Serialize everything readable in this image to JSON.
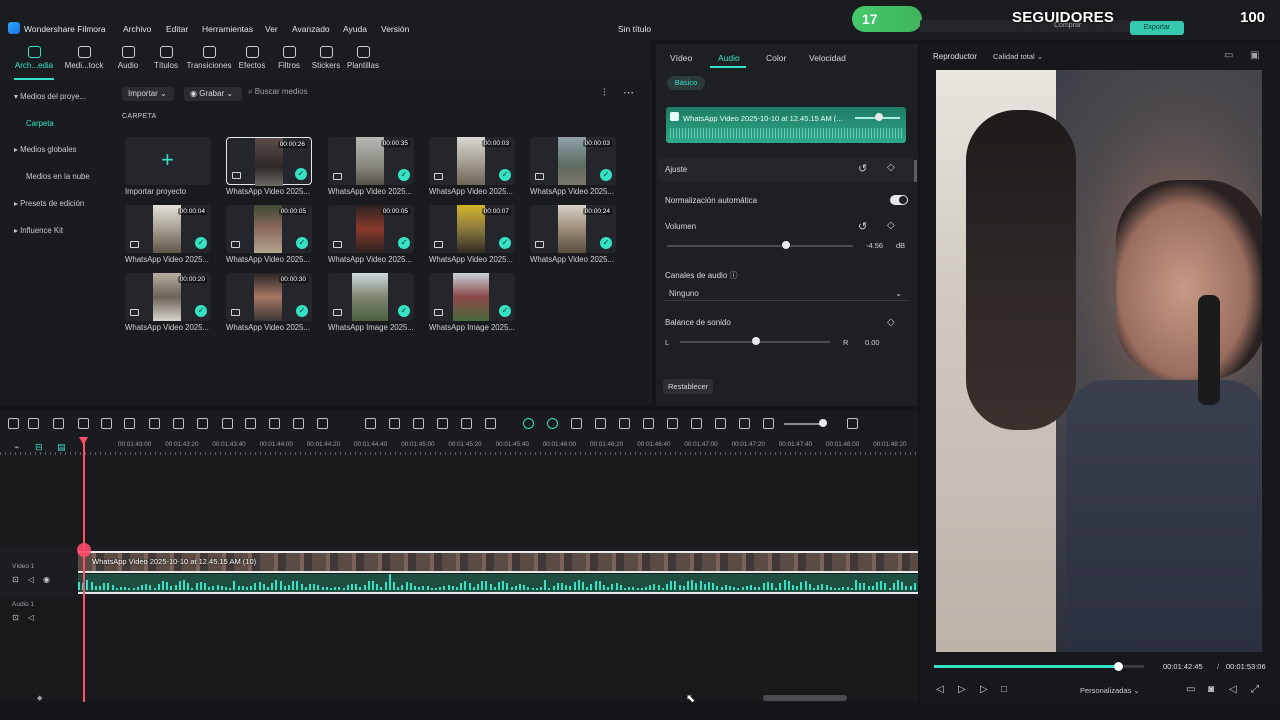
{
  "app": {
    "name": "Wondershare Filmora",
    "doc_title": "Sin título"
  },
  "menu": [
    "Archivo",
    "Editar",
    "Herramientas",
    "Ver",
    "Avanzado",
    "Ayuda",
    "Versión"
  ],
  "overlay": {
    "left_count": "17",
    "label": "SEGUIDORES",
    "right_count": "100",
    "export_label": "Exportar",
    "buy_label": "Comprar"
  },
  "toolbar": {
    "tabs": [
      {
        "label": "Arch...edia",
        "icon": "media-icon"
      },
      {
        "label": "Medi...tock",
        "icon": "stock-icon"
      },
      {
        "label": "Audio",
        "icon": "music-icon"
      },
      {
        "label": "Títulos",
        "icon": "title-icon"
      },
      {
        "label": "Transiciones",
        "icon": "transition-icon"
      },
      {
        "label": "Efectos",
        "icon": "effects-icon"
      },
      {
        "label": "Filtros",
        "icon": "filter-icon"
      },
      {
        "label": "Stickers",
        "icon": "sticker-icon"
      },
      {
        "label": "Plantillas",
        "icon": "template-icon"
      }
    ]
  },
  "leftnav": {
    "items": [
      {
        "label": "Medios del proye...",
        "arrow": "▾"
      },
      {
        "label": "Carpeta",
        "arrow": ""
      },
      {
        "label": "Medios globales",
        "arrow": "▸"
      },
      {
        "label": "Medios en la nube",
        "arrow": ""
      },
      {
        "label": "Presets de edición",
        "arrow": "▸"
      },
      {
        "label": "Influence Kit",
        "arrow": "▸"
      }
    ]
  },
  "media": {
    "import_label": "Importar",
    "record_label": "Grabar",
    "search_placeholder": "Buscar medios",
    "folder_label": "CARPETA",
    "import_project_label": "Importar proyecto",
    "items": [
      {
        "name": "WhatsApp Video 2025...",
        "duration": "00:00:26"
      },
      {
        "name": "WhatsApp Video 2025...",
        "duration": "00:00:35"
      },
      {
        "name": "WhatsApp Video 2025...",
        "duration": "00:00:03"
      },
      {
        "name": "WhatsApp Video 2025...",
        "duration": "00:00:03"
      },
      {
        "name": "WhatsApp Video 2025...",
        "duration": "00:00:04"
      },
      {
        "name": "WhatsApp Video 2025...",
        "duration": "00:00:05"
      },
      {
        "name": "WhatsApp Video 2025...",
        "duration": "00:00:05"
      },
      {
        "name": "WhatsApp Video 2025...",
        "duration": "00:00:07"
      },
      {
        "name": "WhatsApp Video 2025...",
        "duration": "00:00:24"
      },
      {
        "name": "WhatsApp Video 2025...",
        "duration": "00:00:20"
      },
      {
        "name": "WhatsApp Video 2025...",
        "duration": "00:00:30"
      },
      {
        "name": "WhatsApp Image 2025...",
        "duration": ""
      },
      {
        "name": "WhatsApp Image 2025...",
        "duration": ""
      }
    ]
  },
  "props": {
    "tabs": [
      "Vídeo",
      "Audio",
      "Color",
      "Velocidad"
    ],
    "active_tab": "Audio",
    "basic_label": "Básico",
    "clip_name": "WhatsApp Video 2025-10-10 at 12.45.15 AM (...",
    "ajuste_label": "Ajuste",
    "normalize_label": "Normalización automática",
    "volume_label": "Volumen",
    "volume_value": "-4.56",
    "volume_unit": "dB",
    "volume_level": 0.64,
    "channels_label": "Canales de audio",
    "channels_value": "Ninguno",
    "balance_label": "Balance de sonido",
    "balance_left": "L",
    "balance_right": "R",
    "balance_value": "0.00",
    "reset_label": "Restablecer"
  },
  "player": {
    "tab_label": "Reproductor",
    "quality_label": "Calidad total",
    "current_time": "00:01:42:45",
    "total_time": "00:01:53:06",
    "progress": 0.9,
    "display_label": "Personalizadas"
  },
  "timeline": {
    "ticks": [
      "00:01:43:00",
      "00:01:43:20",
      "00:01:43:40",
      "00:01:44:00",
      "00:01:44:20",
      "00:01:44:40",
      "00:01:45:00",
      "00:01:45:20",
      "00:01:45:40",
      "00:01:46:00",
      "00:01:46:20",
      "00:01:46:40",
      "00:01:47:00",
      "00:01:47:20",
      "00:01:47:40",
      "00:01:48:00",
      "00:01:48:20"
    ],
    "video_track": "Vídeo 1",
    "audio_track": "Audio 1",
    "clip_label": "WhatsApp Video 2025-10-10 at 12.45.15 AM (10)"
  },
  "colors": {
    "accent": "#35e3c4",
    "playhead": "#ff4d6a"
  }
}
